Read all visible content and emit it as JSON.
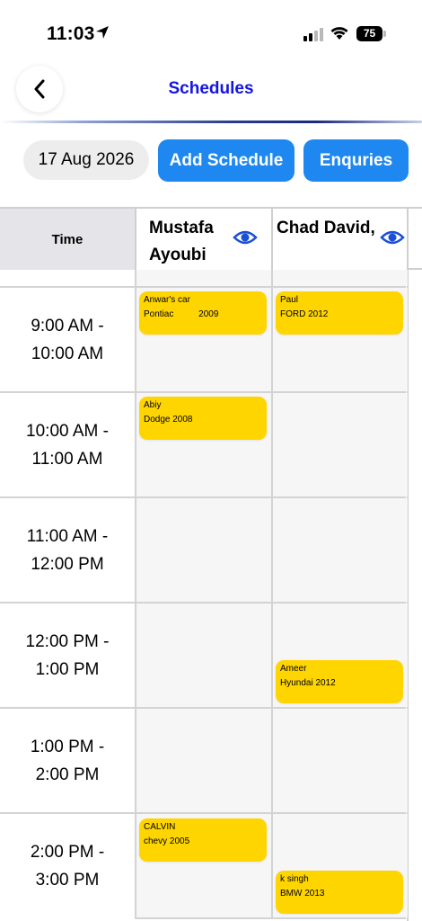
{
  "status_bar": {
    "time": "11:03",
    "battery": "75"
  },
  "nav": {
    "title": "Schedules"
  },
  "toolbar": {
    "date": "17 Aug 2026",
    "add_label": "Add Schedule",
    "enquiries_label": "Enquries"
  },
  "grid": {
    "time_header": "Time",
    "columns": [
      {
        "name": "Mustafa Ayoubi"
      },
      {
        "name": "Chad David, Na..."
      }
    ],
    "rows": [
      {
        "time_line1": "9:00 AM -",
        "time_line2": "10:00 AM"
      },
      {
        "time_line1": "10:00 AM -",
        "time_line2": "11:00 AM"
      },
      {
        "time_line1": "11:00 AM -",
        "time_line2": "12:00 PM"
      },
      {
        "time_line1": "12:00 PM -",
        "time_line2": "1:00 PM"
      },
      {
        "time_line1": "1:00 PM -",
        "time_line2": "2:00 PM"
      },
      {
        "time_line1": "2:00 PM -",
        "time_line2": "3:00 PM"
      }
    ],
    "appointments": [
      {
        "line1": "Anwar's car",
        "line2": "Pontiac          2009"
      },
      {
        "line1": "Paul",
        "line2": "FORD 2012"
      },
      {
        "line1": "Abiy",
        "line2": "Dodge 2008"
      },
      {
        "line1": "Ameer",
        "line2": "Hyundai 2012"
      },
      {
        "line1": "CALVIN",
        "line2": "chevy 2005"
      },
      {
        "line1": "k singh",
        "line2": "BMW 2013"
      }
    ]
  },
  "colors": {
    "accent": "#1e88f0",
    "title": "#1515e0",
    "card": "#ffd500"
  }
}
